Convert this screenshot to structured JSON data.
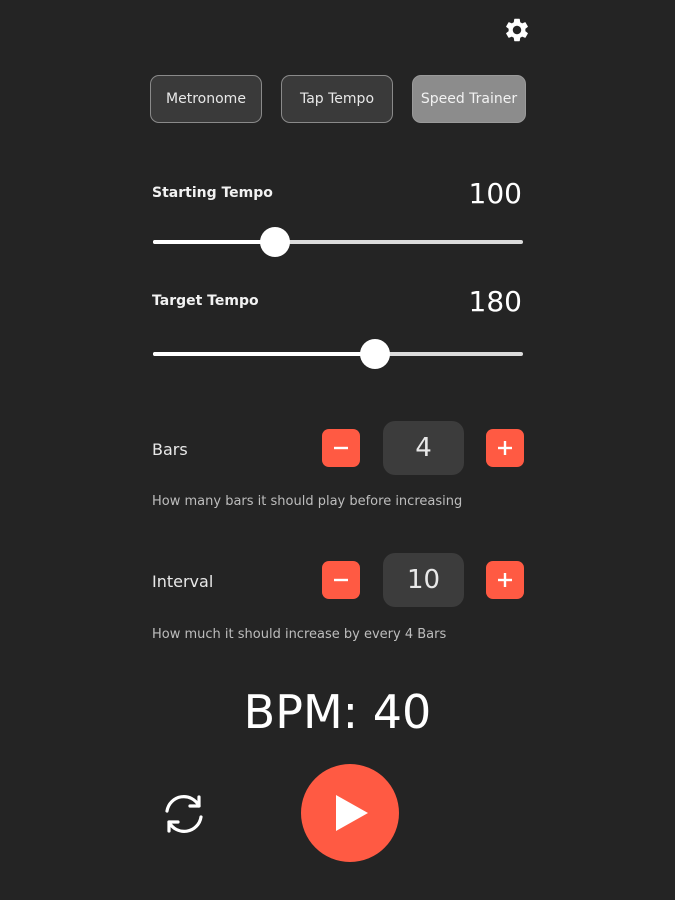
{
  "tabs": [
    {
      "label": "Metronome",
      "active": false
    },
    {
      "label": "Tap Tempo",
      "active": false
    },
    {
      "label": "Speed Trainer",
      "active": true
    }
  ],
  "starting_tempo": {
    "label": "Starting Tempo",
    "value": "100",
    "slider_fraction": 0.33
  },
  "target_tempo": {
    "label": "Target Tempo",
    "value": "180",
    "slider_fraction": 0.6
  },
  "bars": {
    "label": "Bars",
    "value": "4",
    "hint": "How many bars it should play before increasing"
  },
  "interval": {
    "label": "Interval",
    "value": "10",
    "hint": "How much it should increase by every 4 Bars"
  },
  "bpm_readout": "BPM: 40",
  "icons": {
    "settings": "gear-icon",
    "decrement": "minus-icon",
    "increment": "plus-icon",
    "reset": "refresh-icon",
    "play": "play-icon"
  },
  "colors": {
    "background": "#242424",
    "accent": "#ff5a43",
    "active_tab": "#8c8c8c"
  }
}
